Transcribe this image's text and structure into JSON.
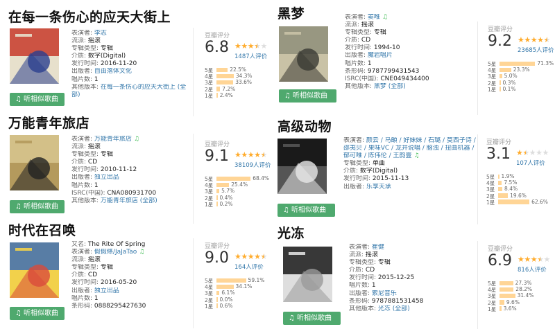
{
  "colors": {
    "accent": "#4fa96e",
    "star": "#ffac2d",
    "bar": "#ffd596",
    "link": "#3377aa"
  },
  "labels": {
    "performer": "表演者: ",
    "alias": "又名: ",
    "genre": "流派: ",
    "album_type": "专辑类型: ",
    "media": "介质: ",
    "release_date": "发行时间: ",
    "publisher": "出版者: ",
    "discs": "唱片数: ",
    "isrc": "ISRC(中国): ",
    "barcode": "条形码: ",
    "other_versions": "其他版本: ",
    "rating_title": "豆瓣评分",
    "listen": "听相似歌曲",
    "stars_levels": [
      "5星",
      "4星",
      "3星",
      "2星",
      "1星"
    ]
  },
  "albums": [
    {
      "title": "在每一条伤心的应天大街上",
      "cover_colors": [
        "#c73a2a",
        "#2b3f8e",
        "#e7e0cc"
      ],
      "rows": [
        {
          "label": "表演者: ",
          "value": "李志",
          "link": true,
          "music": false
        },
        {
          "label": "流派: ",
          "value": "摇滚",
          "link": false,
          "music": false
        },
        {
          "label": "专辑类型: ",
          "value": "专辑",
          "link": false,
          "music": false
        },
        {
          "label": "介质: ",
          "value": "数字(Digital)",
          "link": false,
          "music": false
        },
        {
          "label": "发行时间: ",
          "value": "2016-11-20",
          "link": false,
          "music": false
        },
        {
          "label": "出版者: ",
          "value": "自由落体文化",
          "link": true,
          "music": false
        },
        {
          "label": "唱片数: ",
          "value": "1",
          "link": false,
          "music": false
        },
        {
          "label": "其他版本: ",
          "value": "在每一条伤心的应天大街上 (全",
          "link": true,
          "music": false
        },
        {
          "label": "",
          "value": "部)",
          "link": true,
          "music": false
        }
      ],
      "score": "6.8",
      "stars": 3.5,
      "votes": "1487人评价",
      "dist": [
        22.5,
        34.3,
        33.6,
        7.2,
        2.4
      ],
      "dist_labels": [
        "22.5%",
        "34.3%",
        "33.6%",
        "7.2%",
        "2.4%"
      ]
    },
    {
      "title": "万能青年旅店",
      "cover_colors": [
        "#d8c78f",
        "#222222",
        "#b49a5d"
      ],
      "rows": [
        {
          "label": "表演者: ",
          "value": "万能青年旅店",
          "link": true,
          "music": true
        },
        {
          "label": "流派: ",
          "value": "摇滚",
          "link": false,
          "music": false
        },
        {
          "label": "专辑类型: ",
          "value": "专辑",
          "link": false,
          "music": false
        },
        {
          "label": "介质: ",
          "value": "CD",
          "link": false,
          "music": false
        },
        {
          "label": "发行时间: ",
          "value": "2010-11-12",
          "link": false,
          "music": false
        },
        {
          "label": "出版者: ",
          "value": "独立出品",
          "link": true,
          "music": false
        },
        {
          "label": "唱片数: ",
          "value": "1",
          "link": false,
          "music": false
        },
        {
          "label": "ISRC(中国): ",
          "value": "CNA080931700",
          "link": false,
          "music": false
        },
        {
          "label": "其他版本: ",
          "value": "万能青年旅店 (全部)",
          "link": true,
          "music": false
        }
      ],
      "score": "9.1",
      "stars": 4.5,
      "votes": "38109人评价",
      "dist": [
        68.4,
        25.4,
        5.7,
        0.4,
        0.2
      ],
      "dist_labels": [
        "68.4%",
        "25.4%",
        "5.7%",
        "0.4%",
        "0.2%"
      ]
    },
    {
      "title": "时代在召唤",
      "cover_colors": [
        "#3d6fb5",
        "#d94b3b",
        "#f2d14b"
      ],
      "rows": [
        {
          "label": "又名: ",
          "value": "The Rite Of Spring",
          "link": false,
          "music": false
        },
        {
          "label": "表演者: ",
          "value": "假假條/JaJaTao",
          "link": true,
          "music": true
        },
        {
          "label": "流派: ",
          "value": "摇滚",
          "link": false,
          "music": false
        },
        {
          "label": "专辑类型: ",
          "value": "专辑",
          "link": false,
          "music": false
        },
        {
          "label": "介质: ",
          "value": "CD",
          "link": false,
          "music": false
        },
        {
          "label": "发行时间: ",
          "value": "2016-05-20",
          "link": false,
          "music": false
        },
        {
          "label": "出版者: ",
          "value": "独立出品",
          "link": true,
          "music": false
        },
        {
          "label": "唱片数: ",
          "value": "1",
          "link": false,
          "music": false
        },
        {
          "label": "条形码: ",
          "value": "0888295427630",
          "link": false,
          "music": false
        }
      ],
      "score": "9.0",
      "stars": 4.5,
      "votes": "164人评价",
      "dist": [
        59.1,
        34.1,
        6.1,
        0.0,
        0.6
      ],
      "dist_labels": [
        "59.1%",
        "34.1%",
        "6.1%",
        "0.0%",
        "0.6%"
      ]
    },
    {
      "title": "黑梦",
      "cover_colors": [
        "#8f8f7a",
        "#3a3a33",
        "#c9c2a6"
      ],
      "rows": [
        {
          "label": "表演者: ",
          "value": "窦唯",
          "link": true,
          "music": true
        },
        {
          "label": "流派: ",
          "value": "摇滚",
          "link": false,
          "music": false
        },
        {
          "label": "专辑类型: ",
          "value": "专辑",
          "link": false,
          "music": false
        },
        {
          "label": "介质: ",
          "value": "CD",
          "link": false,
          "music": false
        },
        {
          "label": "发行时间: ",
          "value": "1994-10",
          "link": false,
          "music": false
        },
        {
          "label": "出版者: ",
          "value": "魔岩唱片",
          "link": true,
          "music": false
        },
        {
          "label": "唱片数: ",
          "value": "1",
          "link": false,
          "music": false
        },
        {
          "label": "条形码: ",
          "value": "9787799431543",
          "link": false,
          "music": false
        },
        {
          "label": "ISRC(中国): ",
          "value": "CNE049434400",
          "link": false,
          "music": false
        },
        {
          "label": "其他版本: ",
          "value": "黑梦 (全部)",
          "link": true,
          "music": false
        }
      ],
      "score": "9.2",
      "stars": 4.5,
      "votes": "23685人评价",
      "dist": [
        71.3,
        23.3,
        5.0,
        0.3,
        0.1
      ],
      "dist_labels": [
        "71.3%",
        "23.3%",
        "5.0%",
        "0.3%",
        "0.1%"
      ]
    },
    {
      "title": "高级动物",
      "cover_colors": [
        "#111111",
        "#e8e8e8",
        "#555555"
      ],
      "rows": [
        {
          "label": "表演者: ",
          "value": "颜云 / 马頔 / 好妹妹 / 石璐 / 莫西子诗 /",
          "link": true,
          "music": false
        },
        {
          "label": "",
          "value": "邵夷贝 / 果味VC / 龙井说唱 / 脑浊 / 扭曲机器 /",
          "link": true,
          "music": false
        },
        {
          "label": "",
          "value": "郁可唯 / 陈伟伦 / 王韵壹",
          "link": true,
          "music": true
        },
        {
          "label": "专辑类型: ",
          "value": "单曲",
          "link": false,
          "music": false
        },
        {
          "label": "介质: ",
          "value": "数字(Digital)",
          "link": false,
          "music": false
        },
        {
          "label": "发行时间: ",
          "value": "2015-11-13",
          "link": false,
          "music": false
        },
        {
          "label": "出版者: ",
          "value": "乐享天承",
          "link": true,
          "music": false
        }
      ],
      "score": "3.1",
      "stars": 1.5,
      "votes": "107人评价",
      "dist": [
        1.9,
        7.5,
        8.4,
        19.6,
        62.6
      ],
      "dist_labels": [
        "1.9%",
        "7.5%",
        "8.4%",
        "19.6%",
        "62.6%"
      ]
    },
    {
      "title": "光冻",
      "cover_colors": [
        "#1b1b1b",
        "#9a9a9a",
        "#dedede"
      ],
      "rows": [
        {
          "label": "表演者: ",
          "value": "崔健",
          "link": true,
          "music": false
        },
        {
          "label": "流派: ",
          "value": "摇滚",
          "link": false,
          "music": false
        },
        {
          "label": "专辑类型: ",
          "value": "专辑",
          "link": false,
          "music": false
        },
        {
          "label": "介质: ",
          "value": "CD",
          "link": false,
          "music": false
        },
        {
          "label": "发行时间: ",
          "value": "2015-12-25",
          "link": false,
          "music": false
        },
        {
          "label": "唱片数: ",
          "value": "1",
          "link": false,
          "music": false
        },
        {
          "label": "出版者: ",
          "value": "索尼音乐",
          "link": true,
          "music": false
        },
        {
          "label": "条形码: ",
          "value": "9787881531458",
          "link": false,
          "music": false
        },
        {
          "label": "其他版本: ",
          "value": "光冻 (全部)",
          "link": true,
          "music": false
        }
      ],
      "score": "6.9",
      "stars": 3.5,
      "votes": "816人评价",
      "dist": [
        27.3,
        28.2,
        31.4,
        9.6,
        3.6
      ],
      "dist_labels": [
        "27.3%",
        "28.2%",
        "31.4%",
        "9.6%",
        "3.6%"
      ]
    }
  ]
}
